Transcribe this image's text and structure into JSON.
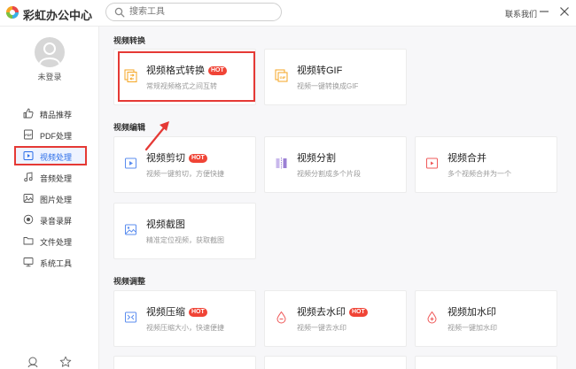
{
  "app": {
    "title": "彩虹办公中心"
  },
  "search": {
    "placeholder": "搜索工具"
  },
  "header": {
    "contact": "联系我们"
  },
  "user": {
    "status": "未登录"
  },
  "sidebar": {
    "items": [
      {
        "label": "精品推荐",
        "icon": "thumbs-up-icon"
      },
      {
        "label": "PDF处理",
        "icon": "pdf-icon"
      },
      {
        "label": "视频处理",
        "icon": "video-icon",
        "active": true
      },
      {
        "label": "音频处理",
        "icon": "music-note-icon"
      },
      {
        "label": "图片处理",
        "icon": "image-icon"
      },
      {
        "label": "录音录屏",
        "icon": "record-icon"
      },
      {
        "label": "文件处理",
        "icon": "folder-icon"
      },
      {
        "label": "系统工具",
        "icon": "monitor-icon"
      }
    ]
  },
  "sections": [
    {
      "title": "视频转换",
      "cards": [
        {
          "title": "视频格式转换",
          "hot": "HOT",
          "desc": "常规视频格式之间互转",
          "icon": "video-convert-icon"
        },
        {
          "title": "视频转GIF",
          "desc": "视频一键转换成GIF",
          "icon": "gif-icon"
        }
      ]
    },
    {
      "title": "视频编辑",
      "cards": [
        {
          "title": "视频剪切",
          "hot": "HOT",
          "desc": "视频一键剪切，方便快捷",
          "icon": "video-cut-icon"
        },
        {
          "title": "视频分割",
          "desc": "视频分割成多个片段",
          "icon": "video-split-icon"
        },
        {
          "title": "视频合并",
          "desc": "多个视频合并为一个",
          "icon": "video-merge-icon"
        },
        {
          "title": "视频截图",
          "desc": "精准定位视频，获取截图",
          "icon": "screenshot-icon"
        }
      ]
    },
    {
      "title": "视频调整",
      "cards": [
        {
          "title": "视频压缩",
          "hot": "HOT",
          "desc": "视频压缩大小，快速便捷",
          "icon": "compress-icon"
        },
        {
          "title": "视频去水印",
          "hot": "HOT",
          "desc": "视频一键去水印",
          "icon": "remove-watermark-icon"
        },
        {
          "title": "视频加水印",
          "desc": "视频一键加水印",
          "icon": "add-watermark-icon"
        }
      ]
    }
  ],
  "colors": {
    "accent": "#2b6de8",
    "annotation_red": "#e53935",
    "hot_badge": "#f04436",
    "icon_orange": "#f5a623",
    "icon_purple": "#9b7fd4",
    "icon_red": "#ef5a5a",
    "icon_blue": "#5b8def"
  }
}
